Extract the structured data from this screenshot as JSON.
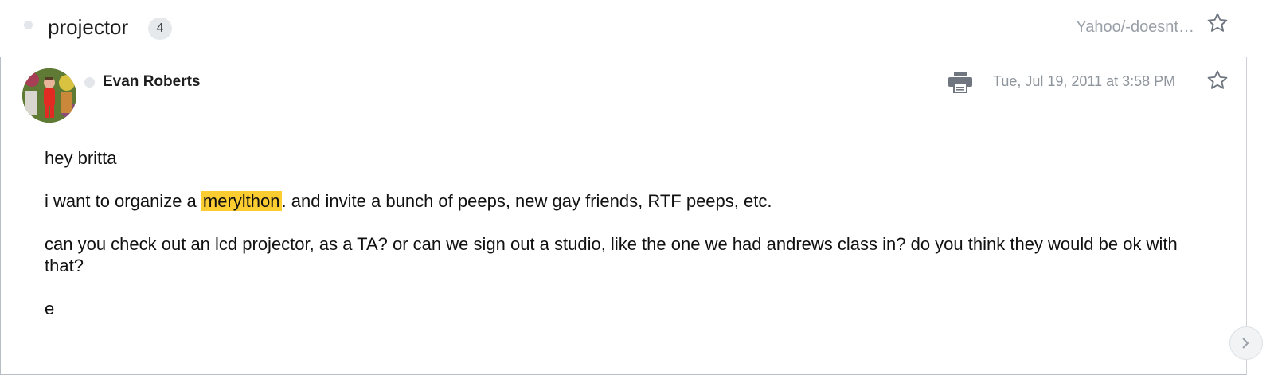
{
  "thread": {
    "subject": "projector",
    "count": "4",
    "folder": "Yahoo/-doesnt…"
  },
  "message": {
    "sender": "Evan Roberts",
    "date": "Tue, Jul 19, 2011 at 3:58 PM",
    "greeting": "hey britta",
    "line2_before": "i want to organize a ",
    "line2_highlight": "merylthon",
    "line2_after": ". and invite a bunch of peeps, new gay friends, RTF peeps, etc.",
    "para3": "can you check out an lcd projector, as a TA? or can we sign out a studio, like the one we had andrews class in? do you think they would be ok with that?",
    "signoff": "e"
  },
  "icons": {
    "thread_star": "star-outline-icon",
    "print": "printer-icon",
    "message_star": "star-outline-icon",
    "next": "chevron-right-icon"
  },
  "colors": {
    "highlight": "#fccd31",
    "muted_text": "#8e949b",
    "badge_bg": "#e6e9ec"
  }
}
